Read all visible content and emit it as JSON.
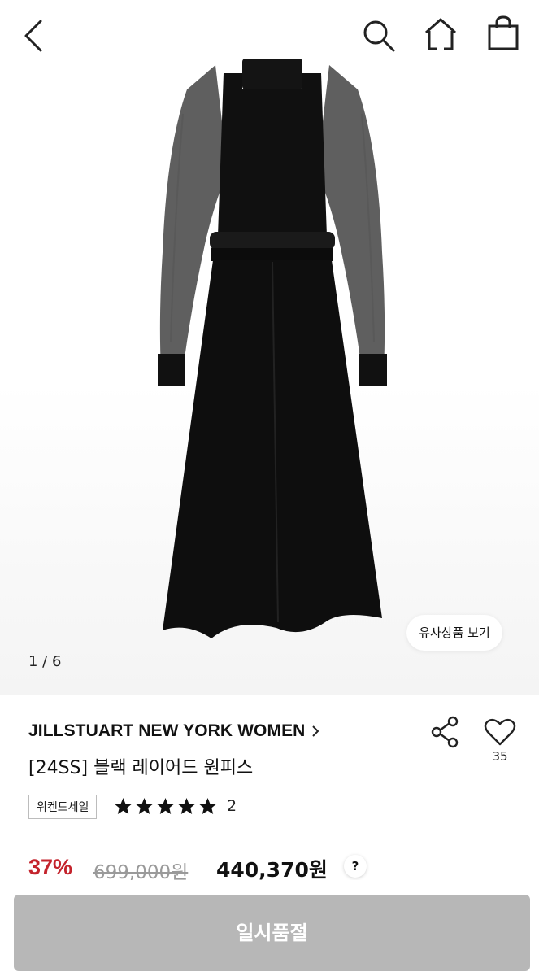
{
  "header": {
    "icons": [
      "back-arrow-icon",
      "search-icon",
      "home-icon",
      "shopping-bag-icon"
    ]
  },
  "gallery": {
    "page_indicator": "1 / 6",
    "similar_button_label": "유사상품 보기"
  },
  "product": {
    "brand": "JILLSTUART NEW YORK WOMEN",
    "name": "[24SS] 블랙 레이어드 원피스",
    "like_count": "35",
    "badge": "위켄드세일",
    "rating": 5,
    "review_count": "2",
    "discount": "37%",
    "original_price": "699,000원",
    "sale_price": "440,370원",
    "price_help": "?"
  },
  "action": {
    "button_label": "일시품절"
  },
  "colors": {
    "discount": "#c4232c",
    "button_disabled": "#b7b7b7"
  }
}
